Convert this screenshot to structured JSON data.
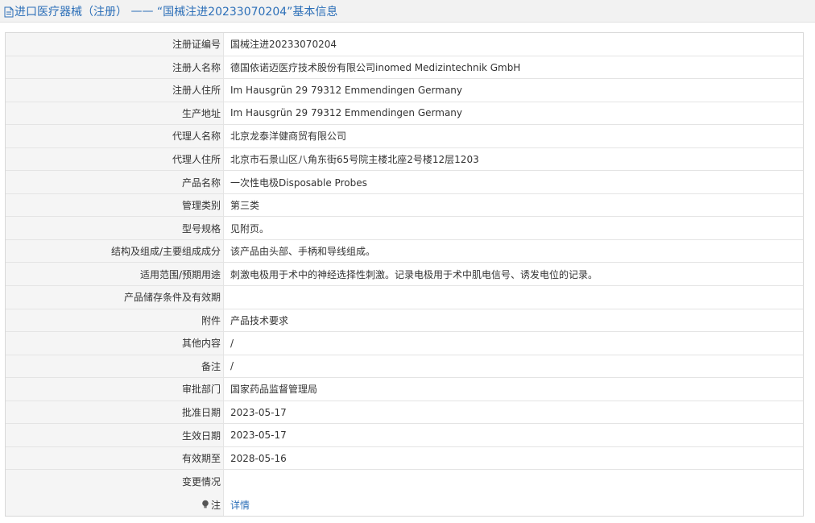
{
  "page": {
    "title_prefix": "进口医疗器械（注册）",
    "title_sep": " —— ",
    "title_main": "“国械注进20233070204”基本信息"
  },
  "rows": [
    {
      "label": "注册证编号",
      "value": "国械注进20233070204"
    },
    {
      "label": "注册人名称",
      "value": "德国依诺迈医疗技术股份有限公司inomed Medizintechnik GmbH"
    },
    {
      "label": "注册人住所",
      "value": "Im Hausgrün 29 79312 Emmendingen Germany"
    },
    {
      "label": "生产地址",
      "value": "Im Hausgrün 29 79312 Emmendingen Germany"
    },
    {
      "label": "代理人名称",
      "value": "北京龙泰洋健商贸有限公司"
    },
    {
      "label": "代理人住所",
      "value": "北京市石景山区八角东街65号院主楼北座2号楼12层1203"
    },
    {
      "label": "产品名称",
      "value": "一次性电极Disposable Probes"
    },
    {
      "label": "管理类别",
      "value": "第三类"
    },
    {
      "label": "型号规格",
      "value": "见附页。"
    },
    {
      "label": "结构及组成/主要组成成分",
      "value": "该产品由头部、手柄和导线组成。"
    },
    {
      "label": "适用范围/预期用途",
      "value": "刺激电极用于术中的神经选择性刺激。记录电极用于术中肌电信号、诱发电位的记录。"
    },
    {
      "label": "产品储存条件及有效期",
      "value": ""
    },
    {
      "label": "附件",
      "value": "产品技术要求"
    },
    {
      "label": "其他内容",
      "value": "/"
    },
    {
      "label": "备注",
      "value": "/"
    },
    {
      "label": "审批部门",
      "value": "国家药品监督管理局"
    },
    {
      "label": "批准日期",
      "value": "2023-05-17"
    },
    {
      "label": "生效日期",
      "value": "2023-05-17"
    },
    {
      "label": "有效期至",
      "value": "2028-05-16"
    },
    {
      "label": "变更情况",
      "value": ""
    }
  ],
  "note": {
    "label": "注",
    "link": "详情",
    "icon": "bulb-icon"
  },
  "colors": {
    "accent": "#2c6fb8",
    "label_bg": "#f5f5f5",
    "border": "#e4e4e4"
  }
}
